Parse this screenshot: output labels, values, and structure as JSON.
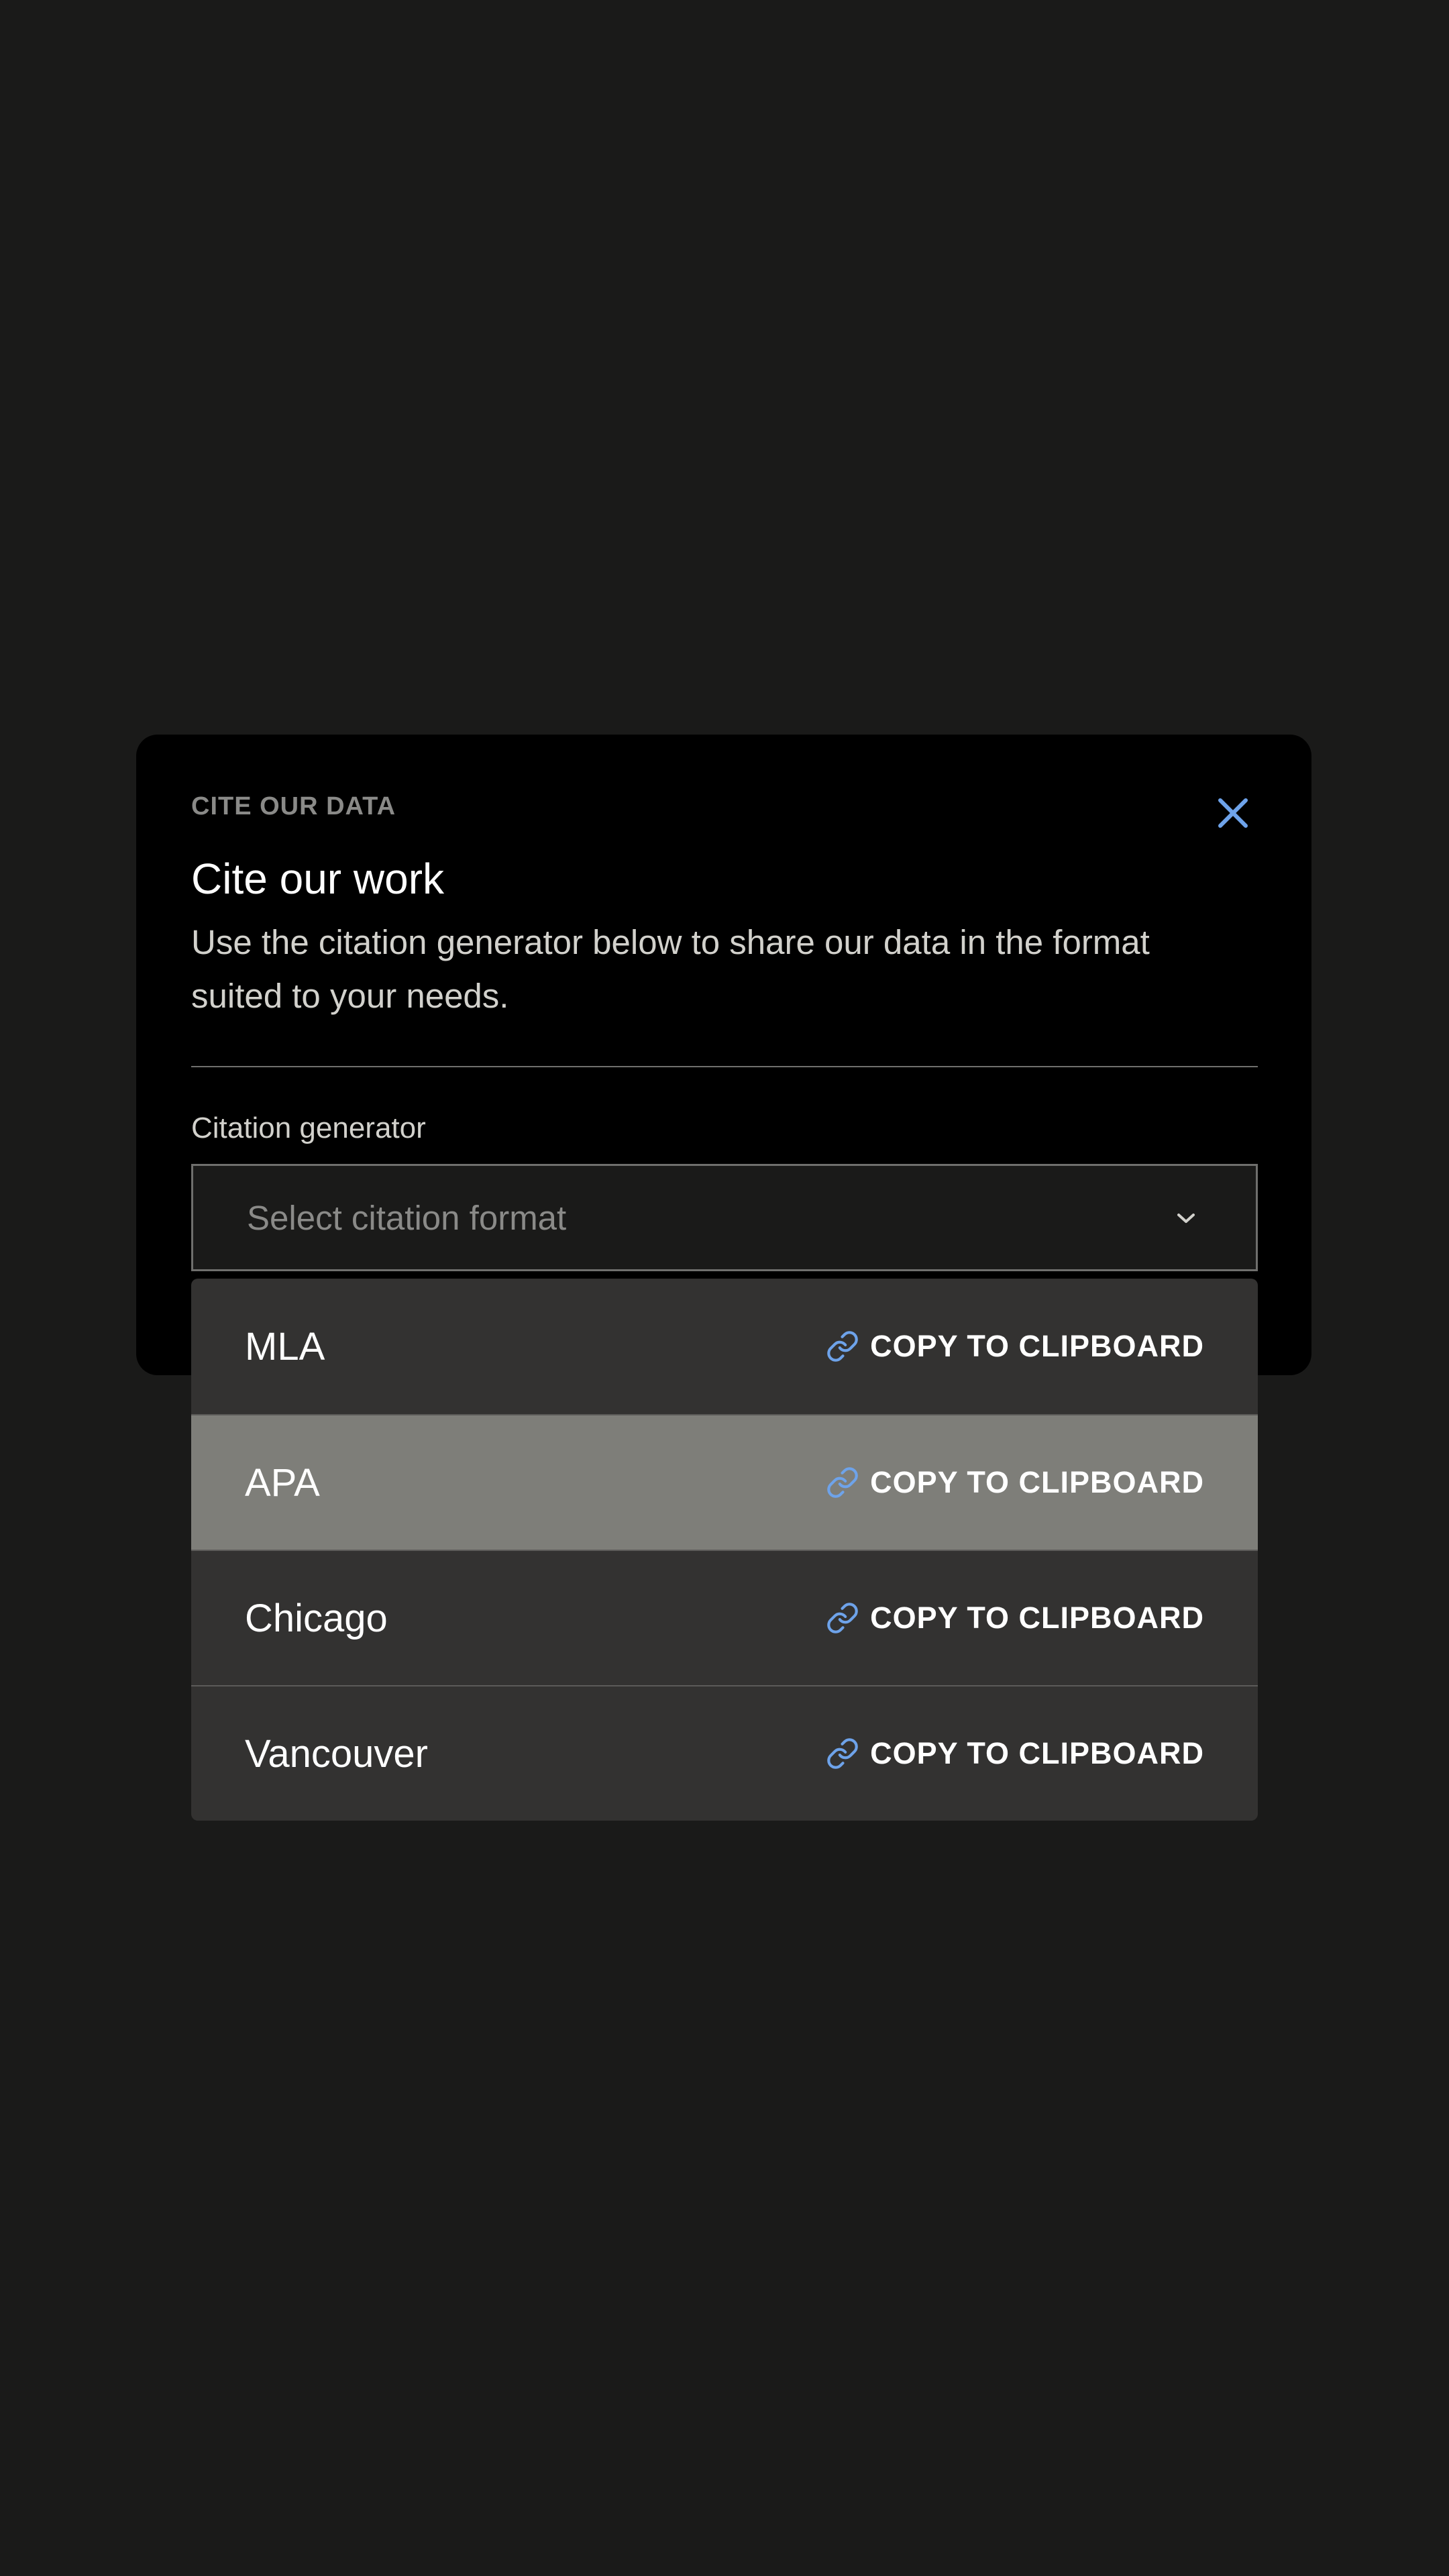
{
  "modal": {
    "eyebrow": "CITE OUR DATA",
    "title": "Cite our work",
    "description": "Use the citation generator below to share our data in the format suited to your needs.",
    "close_icon": "close-icon"
  },
  "citation_generator": {
    "label": "Citation generator",
    "select": {
      "placeholder": "Select citation format",
      "chevron_icon": "chevron-down-icon"
    },
    "options": [
      {
        "label": "MLA",
        "action": "COPY TO CLIPBOARD",
        "icon": "link-icon"
      },
      {
        "label": "APA",
        "action": "COPY TO CLIPBOARD",
        "icon": "link-icon",
        "highlighted": true
      },
      {
        "label": "Chicago",
        "action": "COPY TO CLIPBOARD",
        "icon": "link-icon"
      },
      {
        "label": "Vancouver",
        "action": "COPY TO CLIPBOARD",
        "icon": "link-icon"
      }
    ]
  },
  "colors": {
    "background": "#1a1a19",
    "modal": "#000000",
    "accent": "#6ea3ea",
    "dropdown": "#333231",
    "highlight": "#7e7e79"
  }
}
